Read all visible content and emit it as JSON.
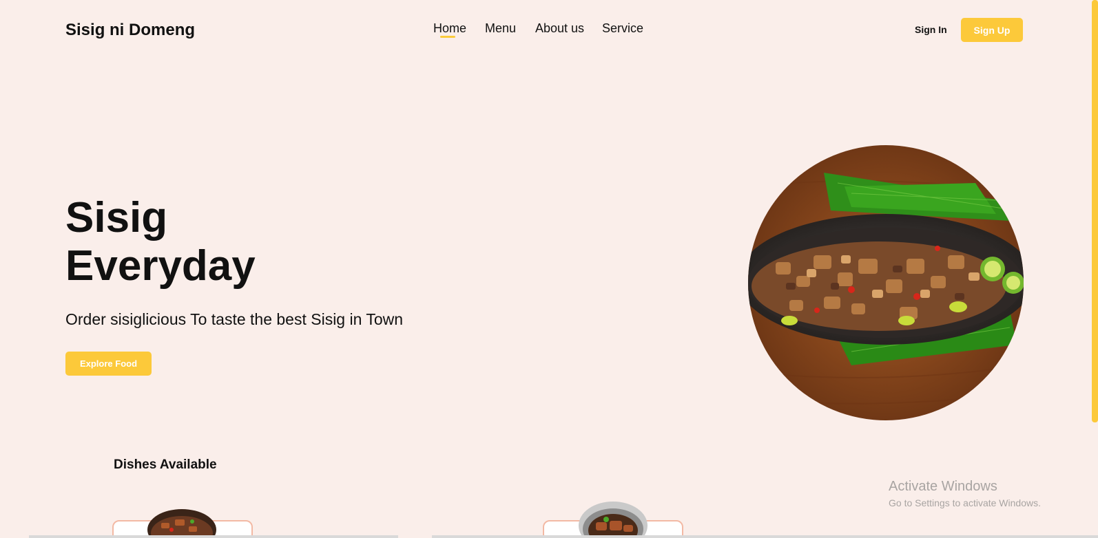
{
  "header": {
    "brand": "Sisig ni Domeng",
    "nav": [
      "Home",
      "Menu",
      "About us",
      "Service"
    ],
    "active_nav": "Home",
    "sign_in": "Sign In",
    "sign_up": "Sign Up"
  },
  "hero": {
    "title_line1": "Sisig",
    "title_line2": "Everyday",
    "subtitle": "Order sisiglicious To taste the best Sisig in Town",
    "cta": "Explore Food"
  },
  "dishes": {
    "title": "Dishes Available"
  },
  "watermark": {
    "title": "Activate Windows",
    "subtitle": "Go to Settings to activate Windows."
  },
  "colors": {
    "background": "#faeeea",
    "accent": "#fcc93a",
    "card_border": "#f3b9a4"
  }
}
